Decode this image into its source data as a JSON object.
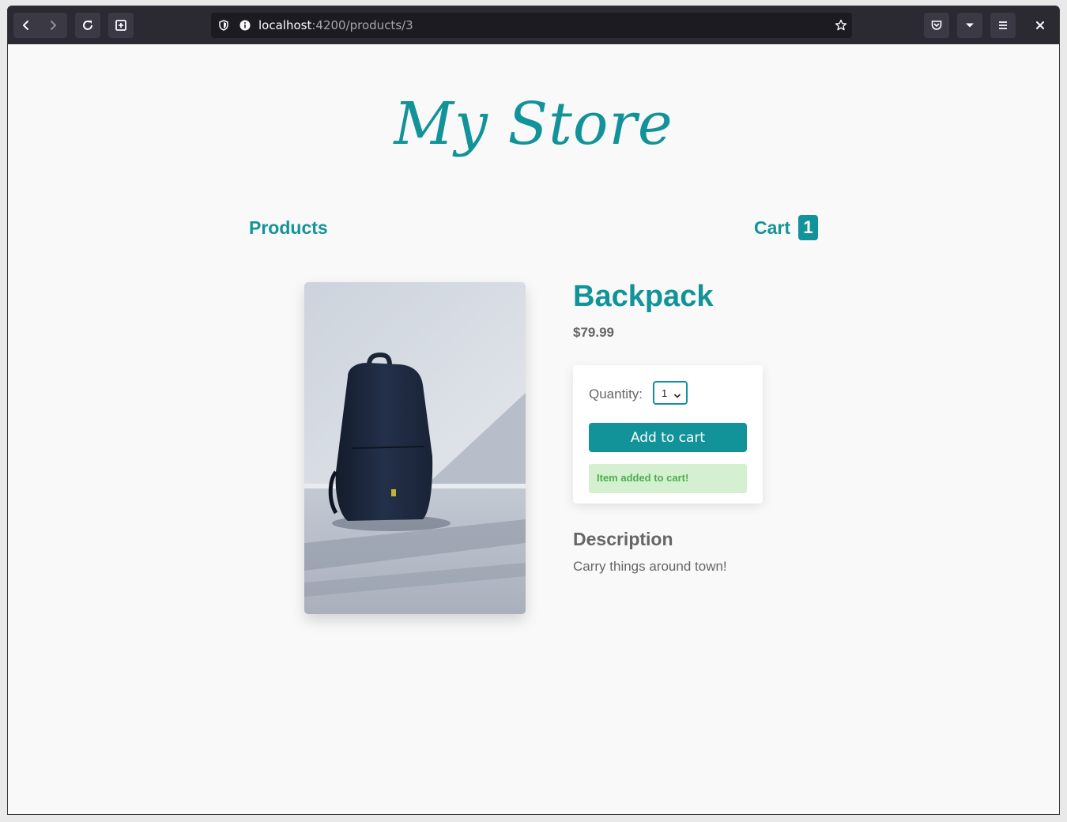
{
  "browser": {
    "url_host": "localhost",
    "url_path": ":4200/products/3"
  },
  "store": {
    "logo": "My Store",
    "nav": {
      "products_label": "Products",
      "cart_label": "Cart",
      "cart_count": "1"
    }
  },
  "product": {
    "name": "Backpack",
    "price": "$79.99",
    "image_alt": "backpack",
    "quantity_label": "Quantity:",
    "quantity_value": "1",
    "add_button_label": "Add to cart",
    "added_message": "Item added to cart!",
    "description_heading": "Description",
    "description_text": "Carry things around town!"
  },
  "colors": {
    "accent": "#12939a",
    "success_bg": "#d4f0d0",
    "success_text": "#4cae4c"
  }
}
